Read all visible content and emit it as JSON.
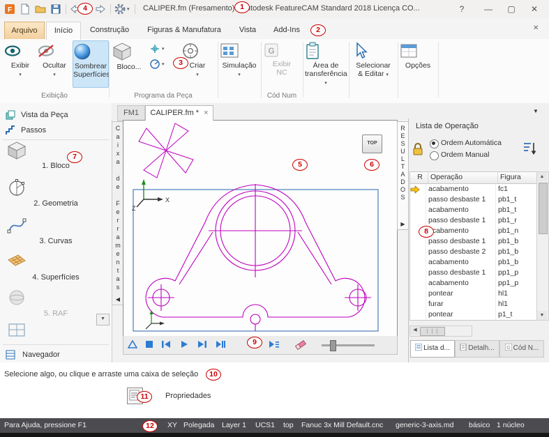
{
  "colors": {
    "magenta": "#bf00bf",
    "stock-blue": "#4a7ebb",
    "accent-blue": "#2b7cd3",
    "annotation-red": "#cc0000",
    "statusbar-bg": "#4c4c50"
  },
  "titlebar": {
    "title": "CALIPER.fm (Fresamento) - Autodesk FeatureCAM Standard 2018 Licença CO...",
    "help": "?",
    "minimize": "—",
    "maximize": "▢",
    "close": "✕"
  },
  "menu": {
    "tabs": [
      "Arquivo",
      "Início",
      "Construção",
      "Figuras & Manufatura",
      "Vista",
      "Add-Ins"
    ],
    "collapse": "✕"
  },
  "ribbon": {
    "exibir": "Exibir",
    "ocultar": "Ocultar",
    "sombrear1": "Sombrear",
    "sombrear2": "Superfícies",
    "group_exibicao": "Exibição",
    "bloco": "Bloco...",
    "criar": "Criar",
    "group_programa": "Programa da Peça",
    "simulacao": "Simulação",
    "exibir_nc1": "Exibir",
    "exibir_nc2": "NC",
    "group_codnum": "Cód Num",
    "area1": "Área de",
    "area2": "transferência",
    "selecionar1": "Selecionar",
    "selecionar2": "& Editar",
    "opcoes": "Opções"
  },
  "sidebar": {
    "vista": "Vista da Peça",
    "passos": "Passos",
    "steps": [
      "1. Bloco",
      "2. Geometria",
      "3. Curvas",
      "4. Superfícies",
      "5. RAF"
    ],
    "navegador": "Navegador"
  },
  "doc_tabs": {
    "tab1": "FM1",
    "tab2": "CALIPER.fm *",
    "close": "×"
  },
  "canvas": {
    "top_button": "TOP",
    "toolbox_strip": "Caixa de Ferramentas",
    "results_strip": "RESULTADOS",
    "axis_x": "X",
    "axis_z": "Z"
  },
  "operations": {
    "title": "Lista de Operação",
    "radio_auto": "Ordem Automática",
    "radio_manual": "Ordem Manual",
    "col_r": "R",
    "col_op": "Operação",
    "col_fig": "Figura",
    "rows": [
      {
        "op": "acabamento",
        "fig": "fc1"
      },
      {
        "op": "passo desbaste 1",
        "fig": "pb1_t"
      },
      {
        "op": "acabamento",
        "fig": "pb1_t"
      },
      {
        "op": "passo desbaste 1",
        "fig": "pb1_r"
      },
      {
        "op": "acabamento",
        "fig": "pb1_n"
      },
      {
        "op": "passo desbaste 1",
        "fig": "pb1_b"
      },
      {
        "op": "passo desbaste 2",
        "fig": "pb1_b"
      },
      {
        "op": "acabamento",
        "fig": "pb1_b"
      },
      {
        "op": "passo desbaste 1",
        "fig": "pp1_p"
      },
      {
        "op": "acabamento",
        "fig": "pp1_p"
      },
      {
        "op": "pontear",
        "fig": "hl1"
      },
      {
        "op": "furar",
        "fig": "hl1"
      },
      {
        "op": "pontear",
        "fig": "p1_t"
      }
    ],
    "tabs": [
      "Lista d...",
      "Detalh...",
      "Cód N..."
    ]
  },
  "hint": "Selecione algo, ou clique e arraste uma caixa de seleção",
  "properties_label": "Propriedades",
  "statusbar": {
    "help": "Para Ajuda, pressione F1",
    "items": [
      "XY",
      "Polegada",
      "Layer 1",
      "UCS1",
      "top",
      "Fanuc 3x Mill Default.cnc",
      "generic-3-axis.md",
      "básico",
      "1 núcleo"
    ]
  },
  "annotations": [
    "1",
    "2",
    "3",
    "4",
    "5",
    "6",
    "7",
    "8",
    "9",
    "10",
    "11",
    "12"
  ]
}
